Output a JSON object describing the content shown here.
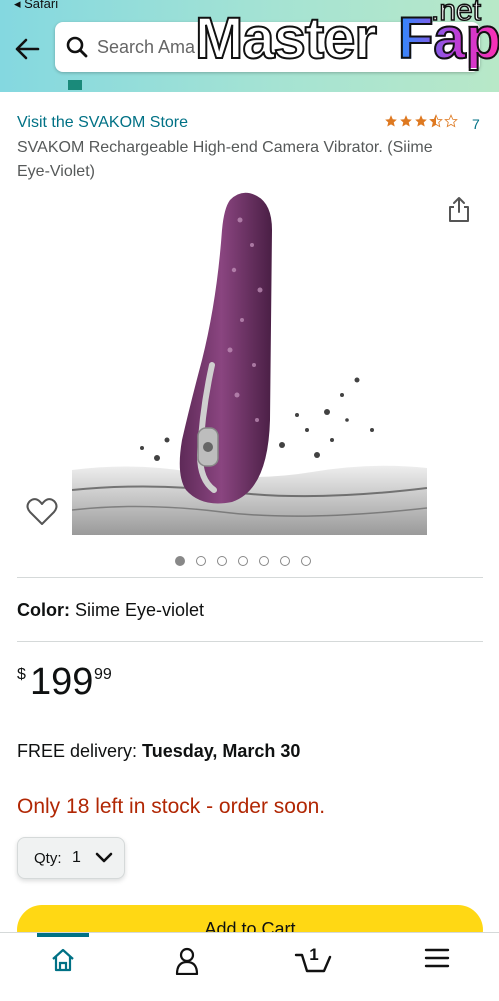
{
  "status_bar": {
    "back_app": "◂ Safari"
  },
  "search": {
    "placeholder": "Search Ama"
  },
  "watermark": {
    "text": "MasterFap",
    "master": "Master",
    "fap": "Fap",
    "tld": ".net"
  },
  "product": {
    "store_link": "Visit the SVAKOM Store",
    "rating": 3.5,
    "review_count": "7",
    "title": "SVAKOM Rechargeable High-end Camera Vibrator. (Siime Eye-Violet)",
    "image_count": 7,
    "active_image_index": 0,
    "color_label": "Color:",
    "color_value": "Siime Eye-violet",
    "price_symbol": "$",
    "price_whole": "199",
    "price_fraction": "99",
    "delivery_prefix": "FREE delivery: ",
    "delivery_date": "Tuesday, March 30",
    "stock_message": "Only 18 left in stock - order soon.",
    "qty_label": "Qty:",
    "qty_value": "1",
    "add_to_cart_label": "Add to Cart"
  },
  "bottom_nav": {
    "cart_count": "1"
  },
  "colors": {
    "link": "#007185",
    "price_red": "#b12704",
    "button_yellow": "#ffd814",
    "star": "#de7921",
    "product_purple": "#7a3a6e"
  }
}
